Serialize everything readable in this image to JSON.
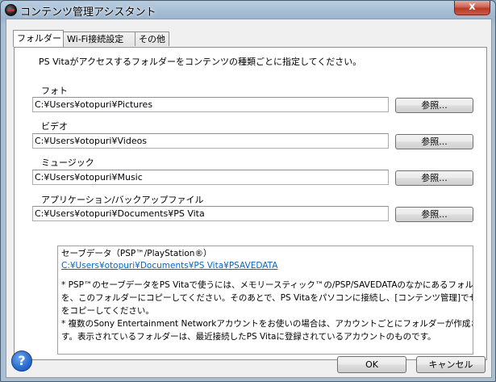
{
  "window": {
    "title": "コンテンツ管理アシスタント",
    "close_label": "x"
  },
  "tabs": [
    {
      "label": "フォルダー",
      "active": true
    },
    {
      "label": "Wi-Fi接続設定",
      "active": false
    },
    {
      "label": "その他",
      "active": false
    }
  ],
  "intro_text": "PS Vitaがアクセスするフォルダーをコンテンツの種類ごとに指定してください。",
  "folders": [
    {
      "label": "フォト",
      "path": "C:¥Users¥otopuri¥Pictures",
      "button": "参照..."
    },
    {
      "label": "ビデオ",
      "path": "C:¥Users¥otopuri¥Videos",
      "button": "参照..."
    },
    {
      "label": "ミュージック",
      "path": "C:¥Users¥otopuri¥Music",
      "button": "参照..."
    },
    {
      "label": "アプリケーション/バックアップファイル",
      "path": "C:¥Users¥otopuri¥Documents¥PS Vita",
      "button": "参照..."
    }
  ],
  "savedata": {
    "heading": "セーブデータ（PSP™/PlayStation®）",
    "link": "C:¥Users¥otopuri¥Documents¥PS Vita¥PSAVEDATA",
    "notes": [
      "* PSP™のセーブデータをPS Vitaで使うには、メモリースティック™の/PSP/SAVEDATAのなかにあるフォルダー",
      "を、このフォルダーにコピーしてください。そのあとで、PS Vitaをパソコンに接続し、[コンテンツ管理]でセーブデータ",
      "をコピーしてください。",
      "* 複数のSony Entertainment Networkアカウントをお使いの場合は、アカウントごとにフォルダーが作成されま",
      "す。表示されているフォルダーは、最近接続したPS Vitaに登録されているアカウントのものです。"
    ]
  },
  "buttons": {
    "ok": "OK",
    "cancel": "キャンセル",
    "help": "?"
  }
}
